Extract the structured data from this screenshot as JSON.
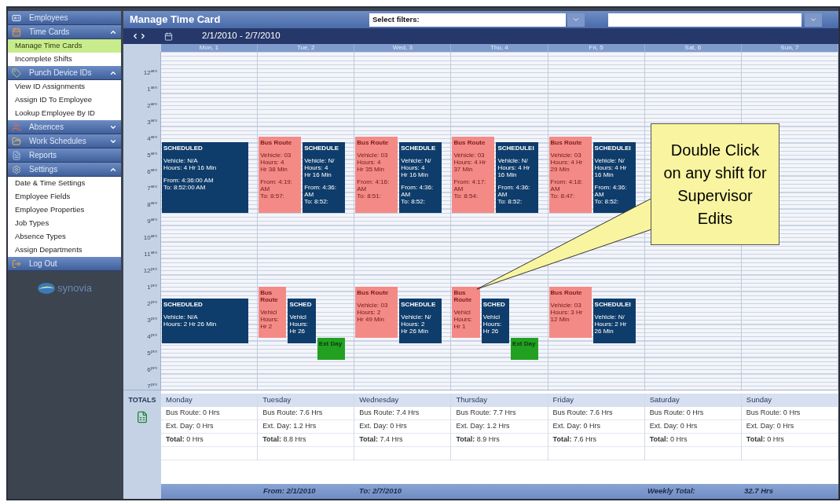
{
  "sidebar": {
    "sections": [
      {
        "title": "Employees"
      },
      {
        "title": "Time Cards",
        "expanded": true,
        "items": [
          {
            "label": "Manage Time Cards",
            "selected": true
          },
          {
            "label": "Incomplete Shifts",
            "selected": false
          }
        ]
      },
      {
        "title": "Punch Device IDs",
        "expanded": true,
        "items": [
          {
            "label": "View ID Assignments",
            "selected": false
          },
          {
            "label": "Assign ID To Employee",
            "selected": false
          },
          {
            "label": "Lookup Employee By ID",
            "selected": false
          }
        ]
      },
      {
        "title": "Absences",
        "expanded": false
      },
      {
        "title": "Work Schedules",
        "expanded": false
      },
      {
        "title": "Reports"
      },
      {
        "title": "Settings",
        "expanded": true,
        "items": [
          {
            "label": "Date & Time Settings",
            "selected": false
          },
          {
            "label": "Employee Fields",
            "selected": false
          },
          {
            "label": "Employee Properties",
            "selected": false
          },
          {
            "label": "Job Types",
            "selected": false
          },
          {
            "label": "Absence Types",
            "selected": false
          },
          {
            "label": "Assign Departments",
            "selected": false
          }
        ]
      },
      {
        "title": "Log Out"
      }
    ],
    "logo": "synovia"
  },
  "header": {
    "title": "Manage Time Card",
    "filter_label": "Select filters:"
  },
  "toolbar": {
    "date_range": "2/1/2010 - 2/7/2010"
  },
  "hours": [
    "12$^{am}$",
    "1$^{am}$",
    "2$^{am}$",
    "3$^{am}$",
    "4$^{am}$",
    "5$^{am}$",
    "6$^{am}$",
    "7$^{am}$",
    "8$^{am}$",
    "9$^{am}$",
    "10$^{am}$",
    "11$^{am}$",
    "12$^{pm}$",
    "1$^{pm}$",
    "2$^{pm}$",
    "3$^{pm}$",
    "4$^{pm}$",
    "5$^{pm}$",
    "6$^{pm}$",
    "7$^{pm}$"
  ],
  "days": [
    {
      "label": "Mon, 1",
      "blocks": [
        {
          "events": [
            {
              "kind": "scheduled",
              "title": "SCHEDULED",
              "groups": [
                [
                  "Vehicle: N/A",
                  "Hours: 4 Hr 16 Min"
                ],
                [
                  "From: 4:36:00 AM",
                  "To: 8:52:00 AM"
                ]
              ]
            }
          ]
        },
        {
          "events": [
            {
              "kind": "scheduled",
              "title": "SCHEDULED",
              "groups": [
                [
                  "Vehicle: N/A",
                  "Hours: 2 Hr 26 Min"
                ]
              ]
            }
          ]
        }
      ]
    },
    {
      "label": "Tue, 2",
      "blocks": [
        {
          "events": [
            {
              "kind": "bus_route",
              "title": "Bus Route",
              "groups": [
                [
                  "Vehicle: 03",
                  "Hours: 4",
                  "Hr 38 Min"
                ],
                [
                  "From: 4:19:",
                  "AM",
                  "To: 8:57:"
                ]
              ]
            },
            {
              "kind": "scheduled",
              "title": "SCHEDULE",
              "groups": [
                [
                  "Vehicle: N/",
                  "Hours: 4",
                  "Hr 16 Min"
                ],
                [
                  "From: 4:36:",
                  "AM",
                  "To: 8:52:"
                ]
              ]
            }
          ]
        },
        {
          "events": [
            {
              "kind": "bus_route",
              "title": "Bus Route",
              "groups": [
                [
                  "Vehicl",
                  "Hours:",
                  "Hr 2"
                ]
              ]
            },
            {
              "kind": "scheduled",
              "title": "SCHED",
              "groups": [
                [
                  "Vehicl",
                  "Hours:",
                  "Hr 26"
                ]
              ]
            },
            {
              "kind": "extra_day",
              "title": "Ext Day"
            }
          ]
        }
      ]
    },
    {
      "label": "Wed, 3",
      "blocks": [
        {
          "events": [
            {
              "kind": "bus_route",
              "title": "Bus Route",
              "groups": [
                [
                  "Vehicle: 03",
                  "Hours: 4",
                  "Hr 35 Min"
                ],
                [
                  "From: 4:16:",
                  "AM",
                  "To: 8:51:"
                ]
              ]
            },
            {
              "kind": "scheduled",
              "title": "SCHEDULE",
              "groups": [
                [
                  "Vehicle: N/",
                  "Hours: 4",
                  "Hr 16 Min"
                ],
                [
                  "From: 4:36:",
                  "AM",
                  "To: 8:52:"
                ]
              ]
            }
          ]
        },
        {
          "events": [
            {
              "kind": "bus_route",
              "title": "Bus Route",
              "groups": [
                [
                  "Vehicle: 03",
                  "Hours: 2",
                  "Hr 49 Min"
                ]
              ]
            },
            {
              "kind": "scheduled",
              "title": "SCHEDULE",
              "groups": [
                [
                  "Vehicle: N/",
                  "Hours: 2",
                  "Hr 26 Min"
                ]
              ]
            }
          ]
        }
      ]
    },
    {
      "label": "Thu, 4",
      "blocks": [
        {
          "events": [
            {
              "kind": "bus_route",
              "title": "Bus Route",
              "groups": [
                [
                  "Vehicle: 03",
                  "Hours: 4 Hr",
                  "37 Min"
                ],
                [
                  "From: 4:17:",
                  "AM",
                  "To: 8:54:"
                ]
              ]
            },
            {
              "kind": "scheduled",
              "title": "SCHEDULEI",
              "groups": [
                [
                  "Vehicle: N/",
                  "Hours: 4 Hr",
                  "16 Min"
                ],
                [
                  "From: 4:36:",
                  "AM",
                  "To: 8:52:"
                ]
              ]
            }
          ]
        },
        {
          "events": [
            {
              "kind": "bus_route",
              "title": "Bus Route",
              "groups": [
                [
                  "Vehicl",
                  "Hours:",
                  "Hr 1"
                ]
              ]
            },
            {
              "kind": "scheduled",
              "title": "SCHED",
              "groups": [
                [
                  "Vehicl",
                  "Hours:",
                  "Hr 26"
                ]
              ]
            },
            {
              "kind": "extra_day",
              "title": "Ext Day"
            }
          ]
        }
      ]
    },
    {
      "label": "Fri, 5",
      "blocks": [
        {
          "events": [
            {
              "kind": "bus_route",
              "title": "Bus Route",
              "groups": [
                [
                  "Vehicle: 03",
                  "Hours: 4 Hr",
                  "29 Min"
                ],
                [
                  "From: 4:18:",
                  "AM",
                  "To: 8:47:"
                ]
              ]
            },
            {
              "kind": "scheduled",
              "title": "SCHEDULEI",
              "groups": [
                [
                  "Vehicle: N/",
                  "Hours: 4 Hr",
                  "16 Min"
                ],
                [
                  "From: 4:36:",
                  "AM",
                  "To: 8:52:"
                ]
              ]
            }
          ]
        },
        {
          "events": [
            {
              "kind": "bus_route",
              "title": "Bus Route",
              "groups": [
                [
                  "Vehicle: 03",
                  "Hours: 3 Hr",
                  "12 Min"
                ]
              ]
            },
            {
              "kind": "scheduled",
              "title": "SCHEDULEI",
              "groups": [
                [
                  "Vehicle: N/",
                  "Hours: 2 Hr",
                  "26 Min"
                ]
              ]
            }
          ]
        }
      ]
    },
    {
      "label": "Sat, 6"
    },
    {
      "label": "Sun, 7"
    }
  ],
  "callout": "Double Click on any shift for Supervisor Edits",
  "totals": {
    "label": "TOTALS",
    "days": [
      {
        "name": "Monday",
        "rows": [
          "Bus Route: 0 Hrs",
          "Ext. Day: 0 Hrs",
          "**Total:** 0 Hrs"
        ]
      },
      {
        "name": "Tuesday",
        "rows": [
          "Bus Route: 7.6 Hrs",
          "Ext. Day: 1.2 Hrs",
          "**Total:** 8.8 Hrs"
        ]
      },
      {
        "name": "Wednesday",
        "rows": [
          "Bus Route: 7.4 Hrs",
          "Ext. Day: 0 Hrs",
          "**Total:** 7.4 Hrs"
        ]
      },
      {
        "name": "Thursday",
        "rows": [
          "Bus Route: 7.7 Hrs",
          "Ext. Day: 1.2 Hrs",
          "**Total:** 8.9 Hrs"
        ]
      },
      {
        "name": "Friday",
        "rows": [
          "Bus Route: 7.6 Hrs",
          "Ext. Day: 0 Hrs",
          "**Total:** 7.6 Hrs"
        ]
      },
      {
        "name": "Saturday",
        "rows": [
          "Bus Route: 0 Hrs",
          "Ext. Day: 0 Hrs",
          "**Total:** 0 Hrs"
        ]
      },
      {
        "name": "Sunday",
        "rows": [
          "Bus Route: 0 Hrs",
          "Ext. Day: 0 Hrs",
          "**Total:** 0 Hrs"
        ]
      }
    ]
  },
  "footer": {
    "from": "From: 2/1/2010",
    "to": "To: 2/7/2010",
    "weekly_label": "Weekly Total:",
    "weekly_total": "32.7 Hrs"
  }
}
